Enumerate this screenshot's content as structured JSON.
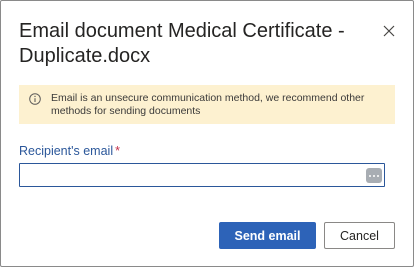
{
  "dialog": {
    "title": "Email document Medical Certificate - Duplicate.docx",
    "close_icon": "close-icon"
  },
  "warning": {
    "icon": "info-icon",
    "text": "Email is an unsecure communication method, we recommend other methods for sending documents",
    "background": "#fdf1d0"
  },
  "recipient": {
    "label": "Recipient's email",
    "required_marker": "*",
    "value": "",
    "placeholder": "",
    "picker_icon": "more-dots-icon"
  },
  "actions": {
    "send_label": "Send email",
    "cancel_label": "Cancel"
  },
  "colors": {
    "accent": "#2d63b8",
    "label": "#2b579a",
    "required": "#c4314b"
  }
}
